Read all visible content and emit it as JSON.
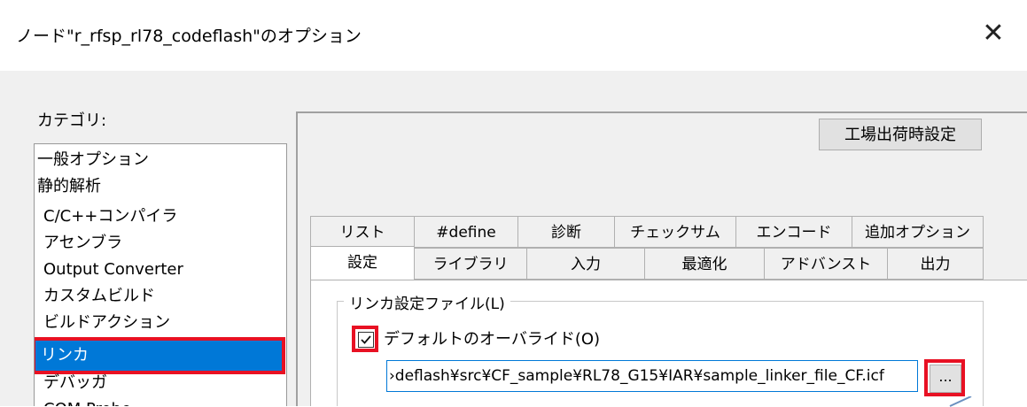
{
  "window": {
    "title": "ノード\"r_rfsp_rl78_codeflash\"のオプション",
    "close_glyph": "✕"
  },
  "category": {
    "label": "カテゴリ:",
    "items": [
      "一般オプション",
      "静的解析",
      "C/C++コンパイラ",
      "アセンブラ",
      "Output Converter",
      "カスタムビルド",
      "ビルドアクション",
      "リンカ",
      "デバッガ",
      "COM Probe"
    ],
    "selected": "リンカ"
  },
  "panel": {
    "factory_button": "工場出荷時設定",
    "tabs_row1": [
      "リスト",
      "#define",
      "診断",
      "チェックサム",
      "エンコード",
      "追加オプション"
    ],
    "tabs_row2": [
      "設定",
      "ライブラリ",
      "入力",
      "最適化",
      "アドバンスト",
      "出力"
    ],
    "active_tab": "設定",
    "group_label": "リンカ設定ファイル(L)",
    "override_label": "デフォルトのオーバライド(O)",
    "override_checked": true,
    "path_value": "›deflash¥src¥CF_sample¥RL78_G15¥IAR¥sample_linker_file_CF.icf",
    "browse_label": "..."
  },
  "colors": {
    "selection": "#0078d7",
    "highlight": "#e81123",
    "button": "#e1e1e1"
  }
}
